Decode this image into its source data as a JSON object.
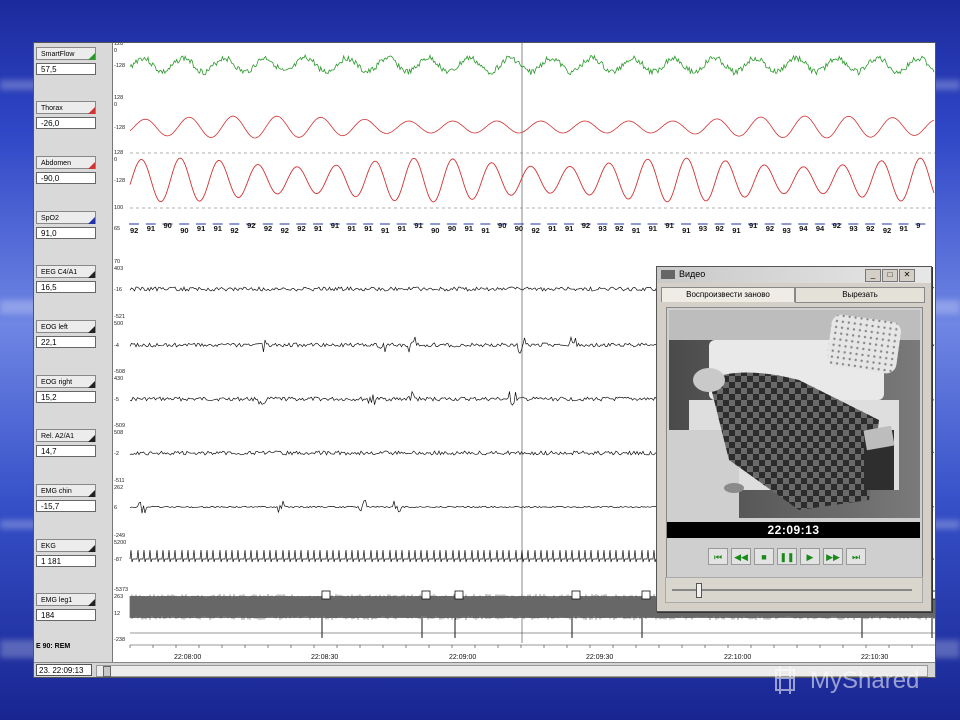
{
  "app": {
    "epoch_label": "E 90: REM",
    "time_field": "23. 22:09:13"
  },
  "channels": [
    {
      "name": "SmartFlow",
      "value": "57,5",
      "scale_top": "128",
      "scale_mid": "0",
      "scale_bot": "-128",
      "color": "#2a9a2a",
      "corner": "#2a9a2a"
    },
    {
      "name": "Thorax",
      "value": "-26,0",
      "scale_top": "128",
      "scale_mid": "0",
      "scale_bot": "-128",
      "color": "#d23232",
      "corner": "#d23232"
    },
    {
      "name": "Abdomen",
      "value": "-90,0",
      "scale_top": "128",
      "scale_mid": "0",
      "scale_bot": "-128",
      "color": "#d23232",
      "corner": "#d23232"
    },
    {
      "name": "SpO2",
      "value": "91,0",
      "scale_top": "100",
      "scale_mid": "",
      "scale_bot": "65",
      "color": "#2233aa",
      "corner": "#2233aa"
    },
    {
      "name": "EEG C4/A1",
      "value": "16,5",
      "scale_top": "70",
      "scale_mid": "403",
      "scale_bot": "-16",
      "color": "#111111",
      "corner": "#222222"
    },
    {
      "name": "EOG left",
      "value": "22,1",
      "scale_top": "-521",
      "scale_mid": "500",
      "scale_bot": "-4",
      "color": "#111111",
      "corner": "#222222"
    },
    {
      "name": "EOG right",
      "value": "15,2",
      "scale_top": "-508",
      "scale_mid": "430",
      "scale_bot": "-5",
      "color": "#111111",
      "corner": "#222222"
    },
    {
      "name": "Rel. A2/A1",
      "value": "14,7",
      "scale_top": "-509",
      "scale_mid": "508",
      "scale_bot": "-2",
      "color": "#111111",
      "corner": "#222222"
    },
    {
      "name": "EMG chin",
      "value": "-15,7",
      "scale_top": "-511",
      "scale_mid": "262",
      "scale_bot": "6",
      "color": "#111111",
      "corner": "#222222"
    },
    {
      "name": "EKG",
      "value": "1 181",
      "scale_top": "-249",
      "scale_mid": "5200",
      "scale_bot": "-87",
      "color": "#111111",
      "corner": "#222222"
    },
    {
      "name": "EMG leg1",
      "value": "184",
      "scale_top": "-5373",
      "scale_mid": "263",
      "scale_bot": "12",
      "color": "#111111",
      "corner": "#222222"
    }
  ],
  "extra_scale": "-238",
  "spo2_values": [
    "92",
    "91",
    "90",
    "90",
    "91",
    "91",
    "92",
    "92",
    "92",
    "92",
    "92",
    "91",
    "91",
    "91",
    "91",
    "91",
    "91",
    "91",
    "90",
    "90",
    "91",
    "91",
    "90",
    "90",
    "92",
    "91",
    "91",
    "92",
    "93",
    "92",
    "91",
    "91",
    "91",
    "91",
    "93",
    "92",
    "91",
    "91",
    "92",
    "93",
    "94",
    "94",
    "92",
    "93",
    "92",
    "92",
    "91",
    "9"
  ],
  "time_axis": [
    "22:08:00",
    "22:08:30",
    "22:09:00",
    "22:09:30",
    "22:10:00",
    "22:10:30"
  ],
  "video": {
    "title": "Видео",
    "tab_replay": "Воспроизвести заново",
    "tab_cut": "Вырезать",
    "timestamp": "22:09:13",
    "slider_value": 0.1,
    "controls": [
      {
        "name": "skip-start",
        "glyph": "⏮"
      },
      {
        "name": "rewind",
        "glyph": "◀◀"
      },
      {
        "name": "stop",
        "glyph": "■"
      },
      {
        "name": "pause",
        "glyph": "❚❚"
      },
      {
        "name": "play",
        "glyph": "▶"
      },
      {
        "name": "fast-forward",
        "glyph": "▶▶"
      },
      {
        "name": "skip-end",
        "glyph": "⏭"
      }
    ]
  },
  "watermark": "MyShared"
}
